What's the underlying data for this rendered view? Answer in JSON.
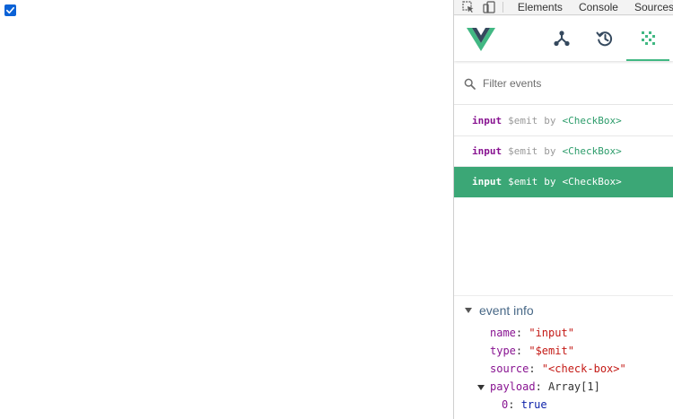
{
  "page": {
    "checkbox_checked": true
  },
  "devtools": {
    "tabs": [
      "Elements",
      "Console",
      "Sources"
    ],
    "header": {
      "buttons": [
        {
          "icon": "components-icon"
        },
        {
          "icon": "history-icon"
        },
        {
          "icon": "events-icon",
          "active": true
        }
      ],
      "accent_color": "#41b883"
    },
    "filter": {
      "placeholder": "Filter events",
      "value": ""
    },
    "events": [
      {
        "name": "input",
        "type": "$emit",
        "by": "by",
        "source": "<CheckBox>",
        "selected": false
      },
      {
        "name": "input",
        "type": "$emit",
        "by": "by",
        "source": "<CheckBox>",
        "selected": false
      },
      {
        "name": "input",
        "type": "$emit",
        "by": "by",
        "source": "<CheckBox>",
        "selected": true
      }
    ],
    "selected_color": "#3ba776",
    "event_info": {
      "title": "event info",
      "name_key": "name",
      "name_value": "\"input\"",
      "type_key": "type",
      "type_value": "\"$emit\"",
      "source_key": "source",
      "source_value": "\"<check-box>\"",
      "payload_key": "payload",
      "payload_value": "Array[1]",
      "item_key": "0",
      "item_value": "true"
    }
  }
}
